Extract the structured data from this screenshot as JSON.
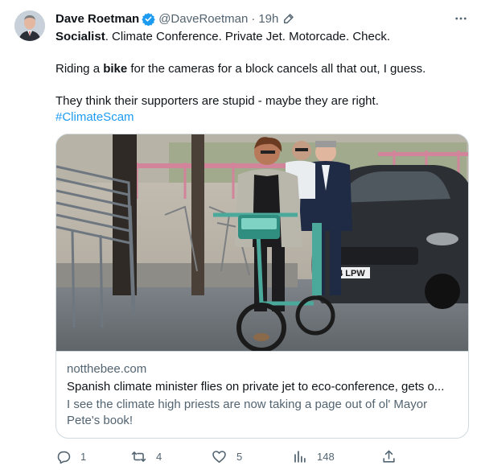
{
  "author": {
    "display_name": "Dave Roetman",
    "handle": "@DaveRoetman",
    "separator": "·",
    "time": "19h"
  },
  "tweet": {
    "line1_bold": "Socialist",
    "line1_rest": ". Climate Conference. Private Jet. Motorcade. Check.",
    "line2_pre": "Riding a ",
    "line2_bold": "bike",
    "line2_post": " for the cameras for a block cancels all that out, I guess.",
    "line3": "They think their supporters are stupid - maybe they are right.",
    "hashtag": "#ClimateScam"
  },
  "card": {
    "image_plate": "24 LPW",
    "domain": "notthebee.com",
    "title": "Spanish climate minister flies on private jet to eco-conference, gets o...",
    "description": "I see the climate high priests are now taking a page out of ol' Mayor Pete's book!"
  },
  "actions": {
    "replies": "1",
    "reposts": "4",
    "likes": "5",
    "views": "148"
  },
  "icons": {
    "verified": "verified-badge-icon",
    "edit": "edit-pencil-icon",
    "more": "more-dots-icon",
    "reply": "reply-icon",
    "repost": "repost-icon",
    "like": "like-heart-icon",
    "views": "views-chart-icon",
    "share": "share-icon"
  },
  "colors": {
    "accent": "#1d9bf0",
    "text": "#0f1419",
    "secondary": "#536471",
    "border": "#cfd9de"
  }
}
